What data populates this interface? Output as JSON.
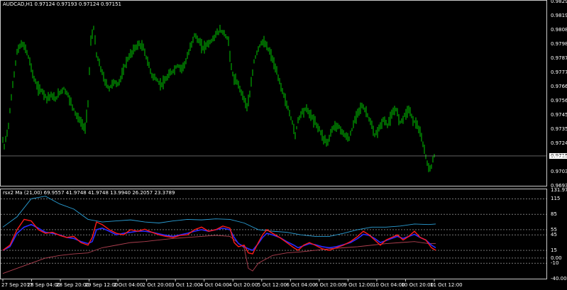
{
  "chart": {
    "header": "AUDCAD,H1  0.97124 0.97193 0.97124 0.97151",
    "current_price": "0.97151",
    "colors": {
      "background": "#000000",
      "bull": "#00c800",
      "grid": "#c8c8c8",
      "rsi_red": "#ff1a1a",
      "rsi_blue": "#2a2aff",
      "ma_light": "#2a9fd6",
      "ma_dark": "#b04050"
    }
  },
  "indicator": {
    "header": "rsx2 Ma (21,00) 69.9557 41.9748 41.9748 13.9940 26.2057 23.3789"
  },
  "price_axis": {
    "ticks": [
      "0.98295",
      "0.98190",
      "0.98085",
      "0.97980",
      "0.97875",
      "0.97770",
      "0.97665",
      "0.97560",
      "0.97455",
      "0.97350",
      "0.97245",
      "0.97140",
      "0.97035",
      "0.96930"
    ]
  },
  "ind_axis": {
    "ticks": [
      "131.973",
      "115",
      "85",
      "55",
      "45",
      "15",
      "0.00",
      "-10",
      "-40.00876"
    ]
  },
  "time_axis": {
    "ticks": [
      "27 Sep 2017",
      "28 Sep 04:00",
      "28 Sep 20:00",
      "29 Sep 12:00",
      "2 Oct 04:00",
      "2 Oct 20:00",
      "3 Oct 12:00",
      "4 Oct 04:00",
      "4 Oct 20:00",
      "5 Oct 12:00",
      "6 Oct 04:00",
      "6 Oct 20:00",
      "9 Oct 12:00",
      "10 Oct 04:00",
      "10 Oct 20:00",
      "11 Oct 12:00"
    ]
  },
  "chart_data": {
    "type": "line",
    "instrument": "AUDCAD,H1",
    "ohlc_last": {
      "open": 0.97124,
      "high": 0.97193,
      "low": 0.97124,
      "close": 0.97151
    },
    "close_path": [
      [
        0,
        0.9735
      ],
      [
        6,
        0.9722
      ],
      [
        12,
        0.9738
      ],
      [
        18,
        0.9768
      ],
      [
        24,
        0.9792
      ],
      [
        30,
        0.9798
      ],
      [
        36,
        0.9795
      ],
      [
        42,
        0.9785
      ],
      [
        48,
        0.9772
      ],
      [
        54,
        0.9765
      ],
      [
        60,
        0.9763
      ],
      [
        66,
        0.9758
      ],
      [
        72,
        0.976
      ],
      [
        78,
        0.9757
      ],
      [
        84,
        0.9762
      ],
      [
        90,
        0.9765
      ],
      [
        96,
        0.976
      ],
      [
        102,
        0.9752
      ],
      [
        108,
        0.9745
      ],
      [
        114,
        0.974
      ],
      [
        120,
        0.9735
      ],
      [
        124,
        0.9755
      ],
      [
        128,
        0.98
      ],
      [
        132,
        0.981
      ],
      [
        136,
        0.979
      ],
      [
        142,
        0.978
      ],
      [
        148,
        0.977
      ],
      [
        154,
        0.9765
      ],
      [
        160,
        0.977
      ],
      [
        166,
        0.9768
      ],
      [
        172,
        0.9775
      ],
      [
        178,
        0.9785
      ],
      [
        184,
        0.979
      ],
      [
        190,
        0.9795
      ],
      [
        196,
        0.9798
      ],
      [
        202,
        0.9795
      ],
      [
        208,
        0.9785
      ],
      [
        214,
        0.9775
      ],
      [
        220,
        0.9772
      ],
      [
        226,
        0.9768
      ],
      [
        232,
        0.977
      ],
      [
        238,
        0.9775
      ],
      [
        244,
        0.9778
      ],
      [
        250,
        0.9782
      ],
      [
        256,
        0.978
      ],
      [
        262,
        0.9785
      ],
      [
        268,
        0.9795
      ],
      [
        274,
        0.9805
      ],
      [
        280,
        0.98
      ],
      [
        286,
        0.9795
      ],
      [
        292,
        0.9798
      ],
      [
        298,
        0.98
      ],
      [
        304,
        0.9805
      ],
      [
        310,
        0.9808
      ],
      [
        316,
        0.9806
      ],
      [
        322,
        0.98
      ],
      [
        326,
        0.978
      ],
      [
        330,
        0.9772
      ],
      [
        336,
        0.9768
      ],
      [
        342,
        0.976
      ],
      [
        348,
        0.9752
      ],
      [
        352,
        0.976
      ],
      [
        358,
        0.9785
      ],
      [
        364,
        0.9795
      ],
      [
        370,
        0.98
      ],
      [
        376,
        0.9796
      ],
      [
        382,
        0.979
      ],
      [
        388,
        0.978
      ],
      [
        394,
        0.977
      ],
      [
        400,
        0.976
      ],
      [
        406,
        0.975
      ],
      [
        412,
        0.974
      ],
      [
        416,
        0.973
      ],
      [
        420,
        0.9742
      ],
      [
        426,
        0.9748
      ],
      [
        432,
        0.975
      ],
      [
        438,
        0.9745
      ],
      [
        444,
        0.974
      ],
      [
        450,
        0.9735
      ],
      [
        456,
        0.9728
      ],
      [
        462,
        0.9725
      ],
      [
        468,
        0.9735
      ],
      [
        474,
        0.9738
      ],
      [
        480,
        0.9735
      ],
      [
        486,
        0.973
      ],
      [
        492,
        0.9728
      ],
      [
        498,
        0.9738
      ],
      [
        504,
        0.9748
      ],
      [
        510,
        0.9752
      ],
      [
        516,
        0.9748
      ],
      [
        522,
        0.974
      ],
      [
        528,
        0.973
      ],
      [
        534,
        0.9735
      ],
      [
        540,
        0.9742
      ],
      [
        546,
        0.9738
      ],
      [
        552,
        0.9745
      ],
      [
        558,
        0.975
      ],
      [
        564,
        0.974
      ],
      [
        570,
        0.9745
      ],
      [
        576,
        0.975
      ],
      [
        582,
        0.9742
      ],
      [
        588,
        0.9738
      ],
      [
        594,
        0.9728
      ],
      [
        600,
        0.9715
      ],
      [
        604,
        0.9705
      ],
      [
        608,
        0.9708
      ],
      [
        612,
        0.9715
      ]
    ],
    "rsx_red": [
      [
        0,
        15
      ],
      [
        10,
        25
      ],
      [
        20,
        55
      ],
      [
        30,
        75
      ],
      [
        40,
        72
      ],
      [
        50,
        55
      ],
      [
        60,
        48
      ],
      [
        70,
        50
      ],
      [
        80,
        44
      ],
      [
        90,
        40
      ],
      [
        100,
        42
      ],
      [
        110,
        30
      ],
      [
        120,
        25
      ],
      [
        126,
        40
      ],
      [
        132,
        70
      ],
      [
        140,
        65
      ],
      [
        150,
        55
      ],
      [
        160,
        48
      ],
      [
        170,
        45
      ],
      [
        180,
        55
      ],
      [
        190,
        52
      ],
      [
        200,
        56
      ],
      [
        210,
        50
      ],
      [
        220,
        45
      ],
      [
        230,
        42
      ],
      [
        240,
        40
      ],
      [
        250,
        44
      ],
      [
        260,
        45
      ],
      [
        270,
        55
      ],
      [
        280,
        60
      ],
      [
        290,
        52
      ],
      [
        300,
        55
      ],
      [
        310,
        62
      ],
      [
        320,
        58
      ],
      [
        326,
        30
      ],
      [
        332,
        22
      ],
      [
        340,
        25
      ],
      [
        346,
        10
      ],
      [
        352,
        8
      ],
      [
        360,
        30
      ],
      [
        366,
        45
      ],
      [
        372,
        55
      ],
      [
        380,
        48
      ],
      [
        390,
        40
      ],
      [
        400,
        30
      ],
      [
        410,
        20
      ],
      [
        416,
        15
      ],
      [
        424,
        25
      ],
      [
        432,
        30
      ],
      [
        440,
        25
      ],
      [
        450,
        18
      ],
      [
        460,
        15
      ],
      [
        470,
        20
      ],
      [
        480,
        25
      ],
      [
        490,
        32
      ],
      [
        500,
        42
      ],
      [
        508,
        52
      ],
      [
        516,
        45
      ],
      [
        524,
        35
      ],
      [
        532,
        25
      ],
      [
        540,
        35
      ],
      [
        548,
        40
      ],
      [
        556,
        45
      ],
      [
        564,
        35
      ],
      [
        572,
        42
      ],
      [
        580,
        52
      ],
      [
        588,
        40
      ],
      [
        596,
        35
      ],
      [
        604,
        20
      ],
      [
        610,
        15
      ]
    ],
    "rsx_blue": [
      [
        0,
        15
      ],
      [
        10,
        22
      ],
      [
        20,
        48
      ],
      [
        30,
        60
      ],
      [
        40,
        65
      ],
      [
        50,
        58
      ],
      [
        60,
        50
      ],
      [
        70,
        48
      ],
      [
        80,
        45
      ],
      [
        90,
        40
      ],
      [
        100,
        38
      ],
      [
        110,
        32
      ],
      [
        120,
        28
      ],
      [
        126,
        32
      ],
      [
        132,
        55
      ],
      [
        140,
        58
      ],
      [
        150,
        52
      ],
      [
        160,
        45
      ],
      [
        170,
        48
      ],
      [
        180,
        50
      ],
      [
        190,
        52
      ],
      [
        200,
        52
      ],
      [
        210,
        50
      ],
      [
        220,
        47
      ],
      [
        230,
        44
      ],
      [
        240,
        42
      ],
      [
        250,
        45
      ],
      [
        260,
        48
      ],
      [
        270,
        52
      ],
      [
        280,
        55
      ],
      [
        290,
        52
      ],
      [
        300,
        55
      ],
      [
        310,
        58
      ],
      [
        320,
        55
      ],
      [
        326,
        40
      ],
      [
        332,
        28
      ],
      [
        340,
        22
      ],
      [
        346,
        18
      ],
      [
        352,
        15
      ],
      [
        360,
        28
      ],
      [
        366,
        40
      ],
      [
        372,
        48
      ],
      [
        380,
        45
      ],
      [
        390,
        40
      ],
      [
        400,
        32
      ],
      [
        410,
        25
      ],
      [
        416,
        20
      ],
      [
        424,
        24
      ],
      [
        432,
        28
      ],
      [
        440,
        26
      ],
      [
        450,
        22
      ],
      [
        460,
        20
      ],
      [
        470,
        22
      ],
      [
        480,
        26
      ],
      [
        490,
        30
      ],
      [
        500,
        38
      ],
      [
        508,
        46
      ],
      [
        516,
        44
      ],
      [
        524,
        38
      ],
      [
        532,
        30
      ],
      [
        540,
        34
      ],
      [
        548,
        38
      ],
      [
        556,
        42
      ],
      [
        564,
        38
      ],
      [
        572,
        42
      ],
      [
        580,
        46
      ],
      [
        588,
        40
      ],
      [
        596,
        35
      ],
      [
        604,
        25
      ],
      [
        610,
        20
      ]
    ],
    "ma_light": [
      [
        0,
        60
      ],
      [
        20,
        80
      ],
      [
        40,
        115
      ],
      [
        60,
        120
      ],
      [
        80,
        105
      ],
      [
        100,
        95
      ],
      [
        120,
        75
      ],
      [
        140,
        70
      ],
      [
        160,
        72
      ],
      [
        180,
        74
      ],
      [
        200,
        70
      ],
      [
        220,
        68
      ],
      [
        240,
        72
      ],
      [
        260,
        75
      ],
      [
        280,
        74
      ],
      [
        300,
        76
      ],
      [
        320,
        75
      ],
      [
        340,
        68
      ],
      [
        360,
        55
      ],
      [
        380,
        52
      ],
      [
        400,
        50
      ],
      [
        420,
        45
      ],
      [
        440,
        42
      ],
      [
        460,
        42
      ],
      [
        480,
        48
      ],
      [
        500,
        55
      ],
      [
        520,
        60
      ],
      [
        540,
        60
      ],
      [
        560,
        62
      ],
      [
        580,
        66
      ],
      [
        600,
        65
      ],
      [
        610,
        66
      ]
    ],
    "ma_dark": [
      [
        0,
        -30
      ],
      [
        20,
        -20
      ],
      [
        40,
        -10
      ],
      [
        60,
        0
      ],
      [
        80,
        5
      ],
      [
        100,
        8
      ],
      [
        120,
        10
      ],
      [
        140,
        20
      ],
      [
        160,
        25
      ],
      [
        180,
        30
      ],
      [
        200,
        32
      ],
      [
        220,
        35
      ],
      [
        240,
        38
      ],
      [
        260,
        40
      ],
      [
        280,
        42
      ],
      [
        300,
        44
      ],
      [
        320,
        42
      ],
      [
        340,
        20
      ],
      [
        346,
        -20
      ],
      [
        352,
        -25
      ],
      [
        360,
        -10
      ],
      [
        380,
        5
      ],
      [
        400,
        10
      ],
      [
        420,
        12
      ],
      [
        440,
        15
      ],
      [
        460,
        18
      ],
      [
        480,
        20
      ],
      [
        500,
        22
      ],
      [
        520,
        25
      ],
      [
        540,
        28
      ],
      [
        560,
        30
      ],
      [
        580,
        32
      ],
      [
        600,
        28
      ],
      [
        610,
        28
      ]
    ],
    "ylim_price": [
      0.9693,
      0.98295
    ],
    "ylim_indicator": [
      -40.00876,
      131.973
    ]
  }
}
